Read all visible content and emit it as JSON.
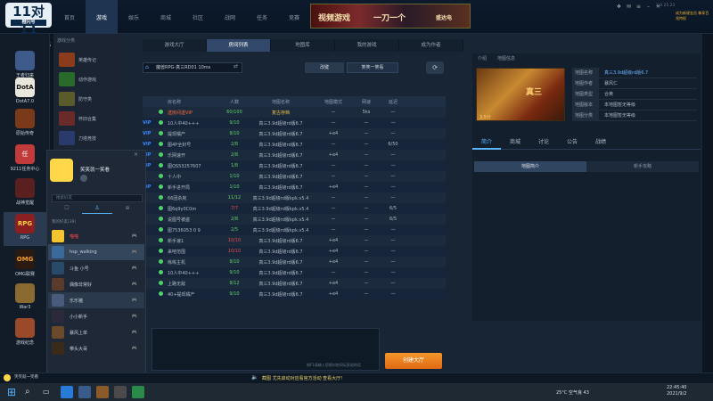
{
  "app": {
    "logo_text": "11对11",
    "logo_sub": "橙闪号",
    "user_id": "3127526",
    "version": "2.0.25.21",
    "promo": "成为新规金员 尊享百兆特权"
  },
  "topnav": [
    {
      "label": "首页"
    },
    {
      "label": "游戏"
    },
    {
      "label": "娱乐"
    },
    {
      "label": "商城"
    },
    {
      "label": "社区"
    },
    {
      "label": "战网"
    },
    {
      "label": "任务"
    },
    {
      "label": "竞赛"
    }
  ],
  "banner": {
    "left": "视频游戏",
    "mid": "一刀一个",
    "right": "盛达电"
  },
  "leftbar": [
    {
      "label": "王者归来"
    },
    {
      "label": "DotA7.0"
    },
    {
      "label": "原始传奇"
    },
    {
      "label": "9211任务中心"
    },
    {
      "label": "战神觉醒"
    },
    {
      "label": "RPG"
    },
    {
      "label": "OMG联赛"
    },
    {
      "label": "War3"
    },
    {
      "label": "游戏纪念"
    }
  ],
  "leftbar_icons": [
    "RPG"
  ],
  "sidebar2": {
    "title": "游戏分类",
    "items": [
      {
        "label": "英雄传记"
      },
      {
        "label": "动作游戏"
      },
      {
        "label": "防守类"
      },
      {
        "label": "怀旧合集"
      },
      {
        "label": "刀塔竞技"
      }
    ]
  },
  "tabs": [
    {
      "label": "游戏大厅"
    },
    {
      "label": "房间列表"
    },
    {
      "label": "地图库"
    },
    {
      "label": "我的游戏"
    },
    {
      "label": "成为作者"
    }
  ],
  "room": {
    "selected": "魔兽RPG-真三RD01 10ms",
    "change_btn": "改键",
    "group_btn": "笑笑一笑看"
  },
  "table": {
    "headers": [
      "",
      "",
      "房名称",
      "人数",
      "地图名称",
      "地图模式",
      "网速",
      "延迟"
    ],
    "rows": [
      {
        "tag": "",
        "name": "送房间送VIP",
        "players": "60/100",
        "map": "复古存档",
        "mode": "—",
        "speed": "5ks",
        "ping": "—"
      },
      {
        "tag": "VIP",
        "name": "10人中40+++",
        "players": "9/10",
        "map": "真三3.9d超级rd版6.7",
        "mode": "—",
        "speed": "—",
        "ping": "—"
      },
      {
        "tag": "VIP",
        "name": "提现橘产",
        "players": "9/10",
        "map": "真三3.9d超级rd版6.7",
        "mode": "+e4",
        "speed": "—",
        "ping": "—"
      },
      {
        "tag": "VIP",
        "name": "图4P全封号",
        "players": "2/8",
        "map": "真三3.9d超级rd版6.7",
        "mode": "—",
        "speed": "—",
        "ping": "6/50"
      },
      {
        "tag": "VIP",
        "name": "乐网速开",
        "players": "2/8",
        "map": "真三3.9d超级rd版6.7",
        "mode": "+e4",
        "speed": "—",
        "ping": "—"
      },
      {
        "tag": "VIP",
        "name": "图QS53257607",
        "players": "1/8",
        "map": "真三3.9d超级rd版6.7",
        "mode": "—",
        "speed": "—",
        "ping": "—"
      },
      {
        "tag": "",
        "name": "十人中",
        "players": "1/10",
        "map": "真三3.9d超级rd版6.7",
        "mode": "—",
        "speed": "—",
        "ping": "—"
      },
      {
        "tag": "VIP",
        "name": "新手进开局",
        "players": "1/10",
        "map": "真三3.9d超级rd版6.7",
        "mode": "+e4",
        "speed": "—",
        "ping": "—"
      },
      {
        "tag": "",
        "name": "66团杀房",
        "players": "11/12",
        "map": "真三3.9d超级rd版kpk.v5.4",
        "mode": "—",
        "speed": "—",
        "ping": "—"
      },
      {
        "tag": "",
        "name": "图6q9y0C0m",
        "players": "7/7",
        "map": "真三3.9d超级rd版kpk.v5.4",
        "mode": "—",
        "speed": "—",
        "ping": "6/5"
      },
      {
        "tag": "",
        "name": "说图号被盗",
        "players": "2/8",
        "map": "真三3.9d超级rd版kpk.v5.4",
        "mode": "—",
        "speed": "—",
        "ping": "6/5"
      },
      {
        "tag": "",
        "name": "图7536053 0 9",
        "players": "2/5",
        "map": "真三3.9d超级rd版kpk.v5.4",
        "mode": "—",
        "speed": "—",
        "ping": "—"
      },
      {
        "tag": "",
        "name": "新手速1",
        "players": "10/10",
        "map": "真三3.9d超级rd版6.7",
        "mode": "+e4",
        "speed": "—",
        "ping": "—"
      },
      {
        "tag": "",
        "name": "来吧范围",
        "players": "10/10",
        "map": "真三3.9d超级rd版6.7",
        "mode": "+e4",
        "speed": "—",
        "ping": "—"
      },
      {
        "tag": "",
        "name": "练练主机",
        "players": "9/10",
        "map": "真三3.9d超级rd版6.7",
        "mode": "+e4",
        "speed": "—",
        "ping": "—"
      },
      {
        "tag": "",
        "name": "10人中40+++",
        "players": "9/10",
        "map": "真三3.9d超级rd版6.7",
        "mode": "—",
        "speed": "—",
        "ping": "—"
      },
      {
        "tag": "",
        "name": "上路无敌",
        "players": "9/12",
        "map": "真三3.9d超级rd版6.7",
        "mode": "+e4",
        "speed": "—",
        "ping": "—"
      },
      {
        "tag": "",
        "name": "40+提现橘产",
        "players": "9/10",
        "map": "真三3.9d超级rd版6.7",
        "mode": "+e4",
        "speed": "—",
        "ping": "—"
      }
    ]
  },
  "chat": {
    "meta": "按F1请输入您想对房间玩家说的话",
    "join_btn": "创建大厅"
  },
  "right": {
    "top_tabs": [
      "介绍",
      "地图信息"
    ],
    "game_title": "真三",
    "score": "3.5分",
    "info": [
      {
        "k": "地图名称",
        "v": "真三3.9d超级rd版6.7"
      },
      {
        "k": "地图作者",
        "v": "暴风仁"
      },
      {
        "k": "地图类型",
        "v": "合英"
      },
      {
        "k": "地图版本",
        "v": "本地图暂无等级"
      },
      {
        "k": "地图分类",
        "v": "本地图暂无等级"
      }
    ],
    "tabs": [
      "简介",
      "商城",
      "讨论",
      "公告",
      "战绩"
    ],
    "subtabs": [
      "地图简介",
      "新手攻略"
    ]
  },
  "friend": {
    "name": "笑笑就一笑看",
    "search_placeholder": "搜索好友",
    "group": "我的好友(39)",
    "items": [
      {
        "name": "喵喵"
      },
      {
        "name": "hsp_walking"
      },
      {
        "name": "斗鱼 小号"
      },
      {
        "name": "偶像非常好"
      },
      {
        "name": "乐乐猪"
      },
      {
        "name": "小小新手"
      },
      {
        "name": "暴风上单"
      },
      {
        "name": "带头大哥"
      }
    ]
  },
  "statusbar": {
    "user": "笑笑就一笑看",
    "notice": "截图 尤先启动对应看官方活动 查看大厅!"
  },
  "taskbar": {
    "temp": "25°C 空气良 43",
    "time": "22:45:40",
    "date": "2021/9/2"
  }
}
